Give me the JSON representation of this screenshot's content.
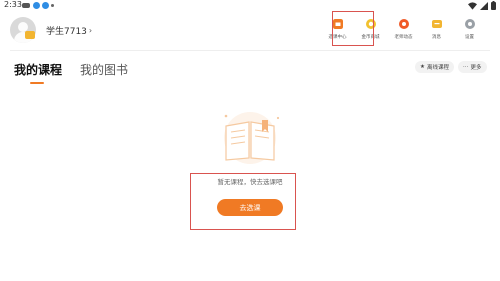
{
  "status_bar": {
    "time": "2:33"
  },
  "profile": {
    "username": "学生7713",
    "chevron": "›"
  },
  "top_nav": [
    {
      "label": "选课中心",
      "icon": "course-center-icon",
      "color": "#f07a24"
    },
    {
      "label": "金币商城",
      "icon": "coin-mall-icon",
      "color": "#f2c12e"
    },
    {
      "label": "老师动态",
      "icon": "teacher-feed-icon",
      "color": "#f05a28"
    },
    {
      "label": "消息",
      "icon": "message-icon",
      "color": "#f2b531"
    },
    {
      "label": "设置",
      "icon": "gear-icon",
      "color": "#9aa0a6"
    }
  ],
  "tabs": {
    "my_courses": "我的课程",
    "my_books": "我的图书"
  },
  "actions": {
    "offline_courses": "离线课程",
    "more": "更多"
  },
  "empty_state": {
    "message": "暂无课程，快去选课吧",
    "button": "去选课"
  },
  "colors": {
    "accent": "#f07a24",
    "highlight_border": "#d9534f"
  }
}
